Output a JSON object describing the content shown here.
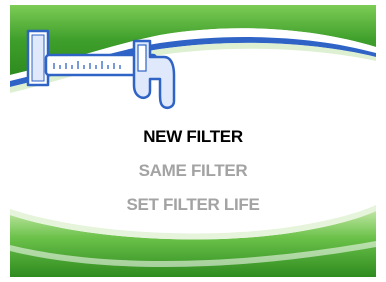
{
  "menu": {
    "items": [
      {
        "label": "NEW FILTER",
        "selected": true
      },
      {
        "label": "SAME FILTER",
        "selected": false
      },
      {
        "label": "SET FILTER LIFE",
        "selected": false
      }
    ]
  },
  "colors": {
    "green_dark": "#2e8b1f",
    "green_mid": "#57b63a",
    "green_light": "#9bd77a",
    "accent_blue": "#2f63c6",
    "selected_text": "#000000",
    "dim_text": "#a3a3a3"
  },
  "icons": {
    "header_icon": "caliper-ruler-icon"
  }
}
